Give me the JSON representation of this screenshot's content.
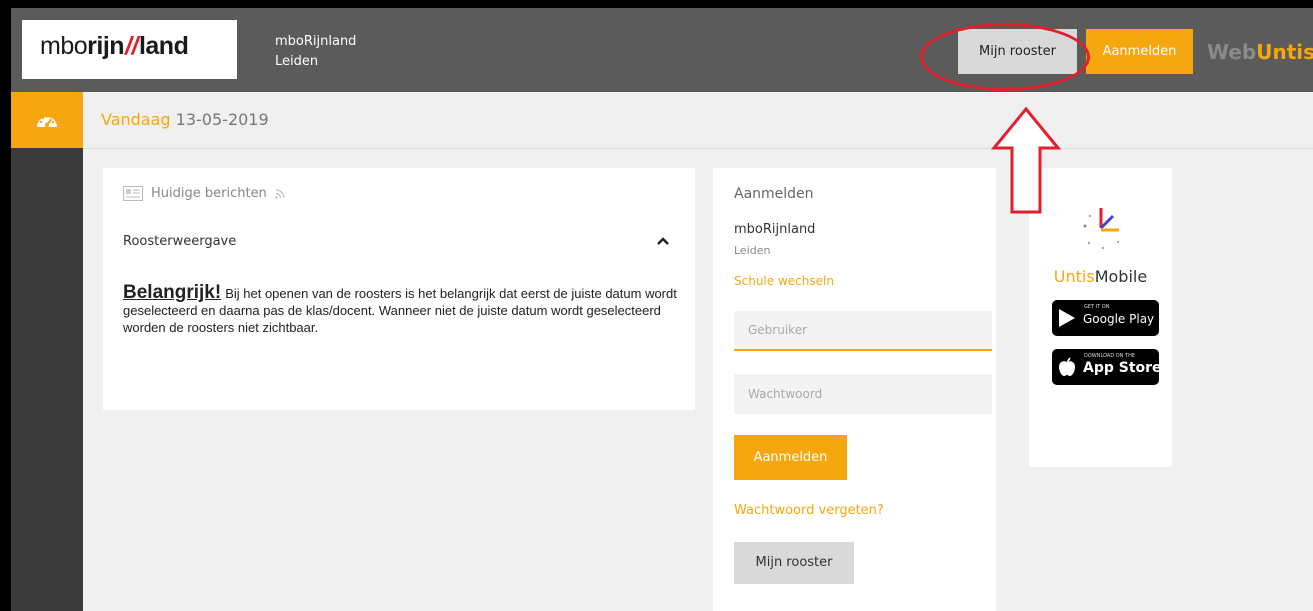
{
  "header": {
    "logo_text": {
      "part1": "mbo",
      "part2": "rijn",
      "part3": "land"
    },
    "school_name": "mboRijnland",
    "school_city": "Leiden",
    "my_schedule_label": "Mijn rooster",
    "login_label": "Aanmelden",
    "brand": {
      "part1": "Web",
      "part2": "Untis"
    }
  },
  "sidebar": {
    "items": [
      {
        "icon": "dashboard-icon"
      }
    ]
  },
  "datebar": {
    "label": "Vandaag",
    "date": "13-05-2019"
  },
  "news": {
    "header": "Huidige berichten",
    "subheader": "Roosterweergave",
    "important_label": "Belangrijk!",
    "text": "Bij het openen van de roosters is het belangrijk dat eerst de juiste datum wordt geselecteerd en daarna pas de klas/docent. Wanneer niet de juiste datum wordt geselecteerd worden de roosters niet zichtbaar."
  },
  "login": {
    "title": "Aanmelden",
    "school_name": "mboRijnland",
    "school_city": "Leiden",
    "switch_school": "Schule wechseln",
    "username_placeholder": "Gebruiker",
    "password_placeholder": "Wachtwoord",
    "login_button": "Aanmelden",
    "forgot_password": "Wachtwoord vergeten?",
    "my_schedule_button": "Mijn rooster"
  },
  "mobile": {
    "name_part1": "Untis",
    "name_part2": "Mobile",
    "google_play": {
      "small": "GET IT ON",
      "big": "Google Play"
    },
    "app_store": {
      "small": "Download on the",
      "big": "App Store"
    }
  },
  "colors": {
    "accent": "#f7a70e",
    "header_bg": "#5b5b5b",
    "sidebar_bg": "#3b3b3b",
    "annotation": "#e2202c"
  }
}
